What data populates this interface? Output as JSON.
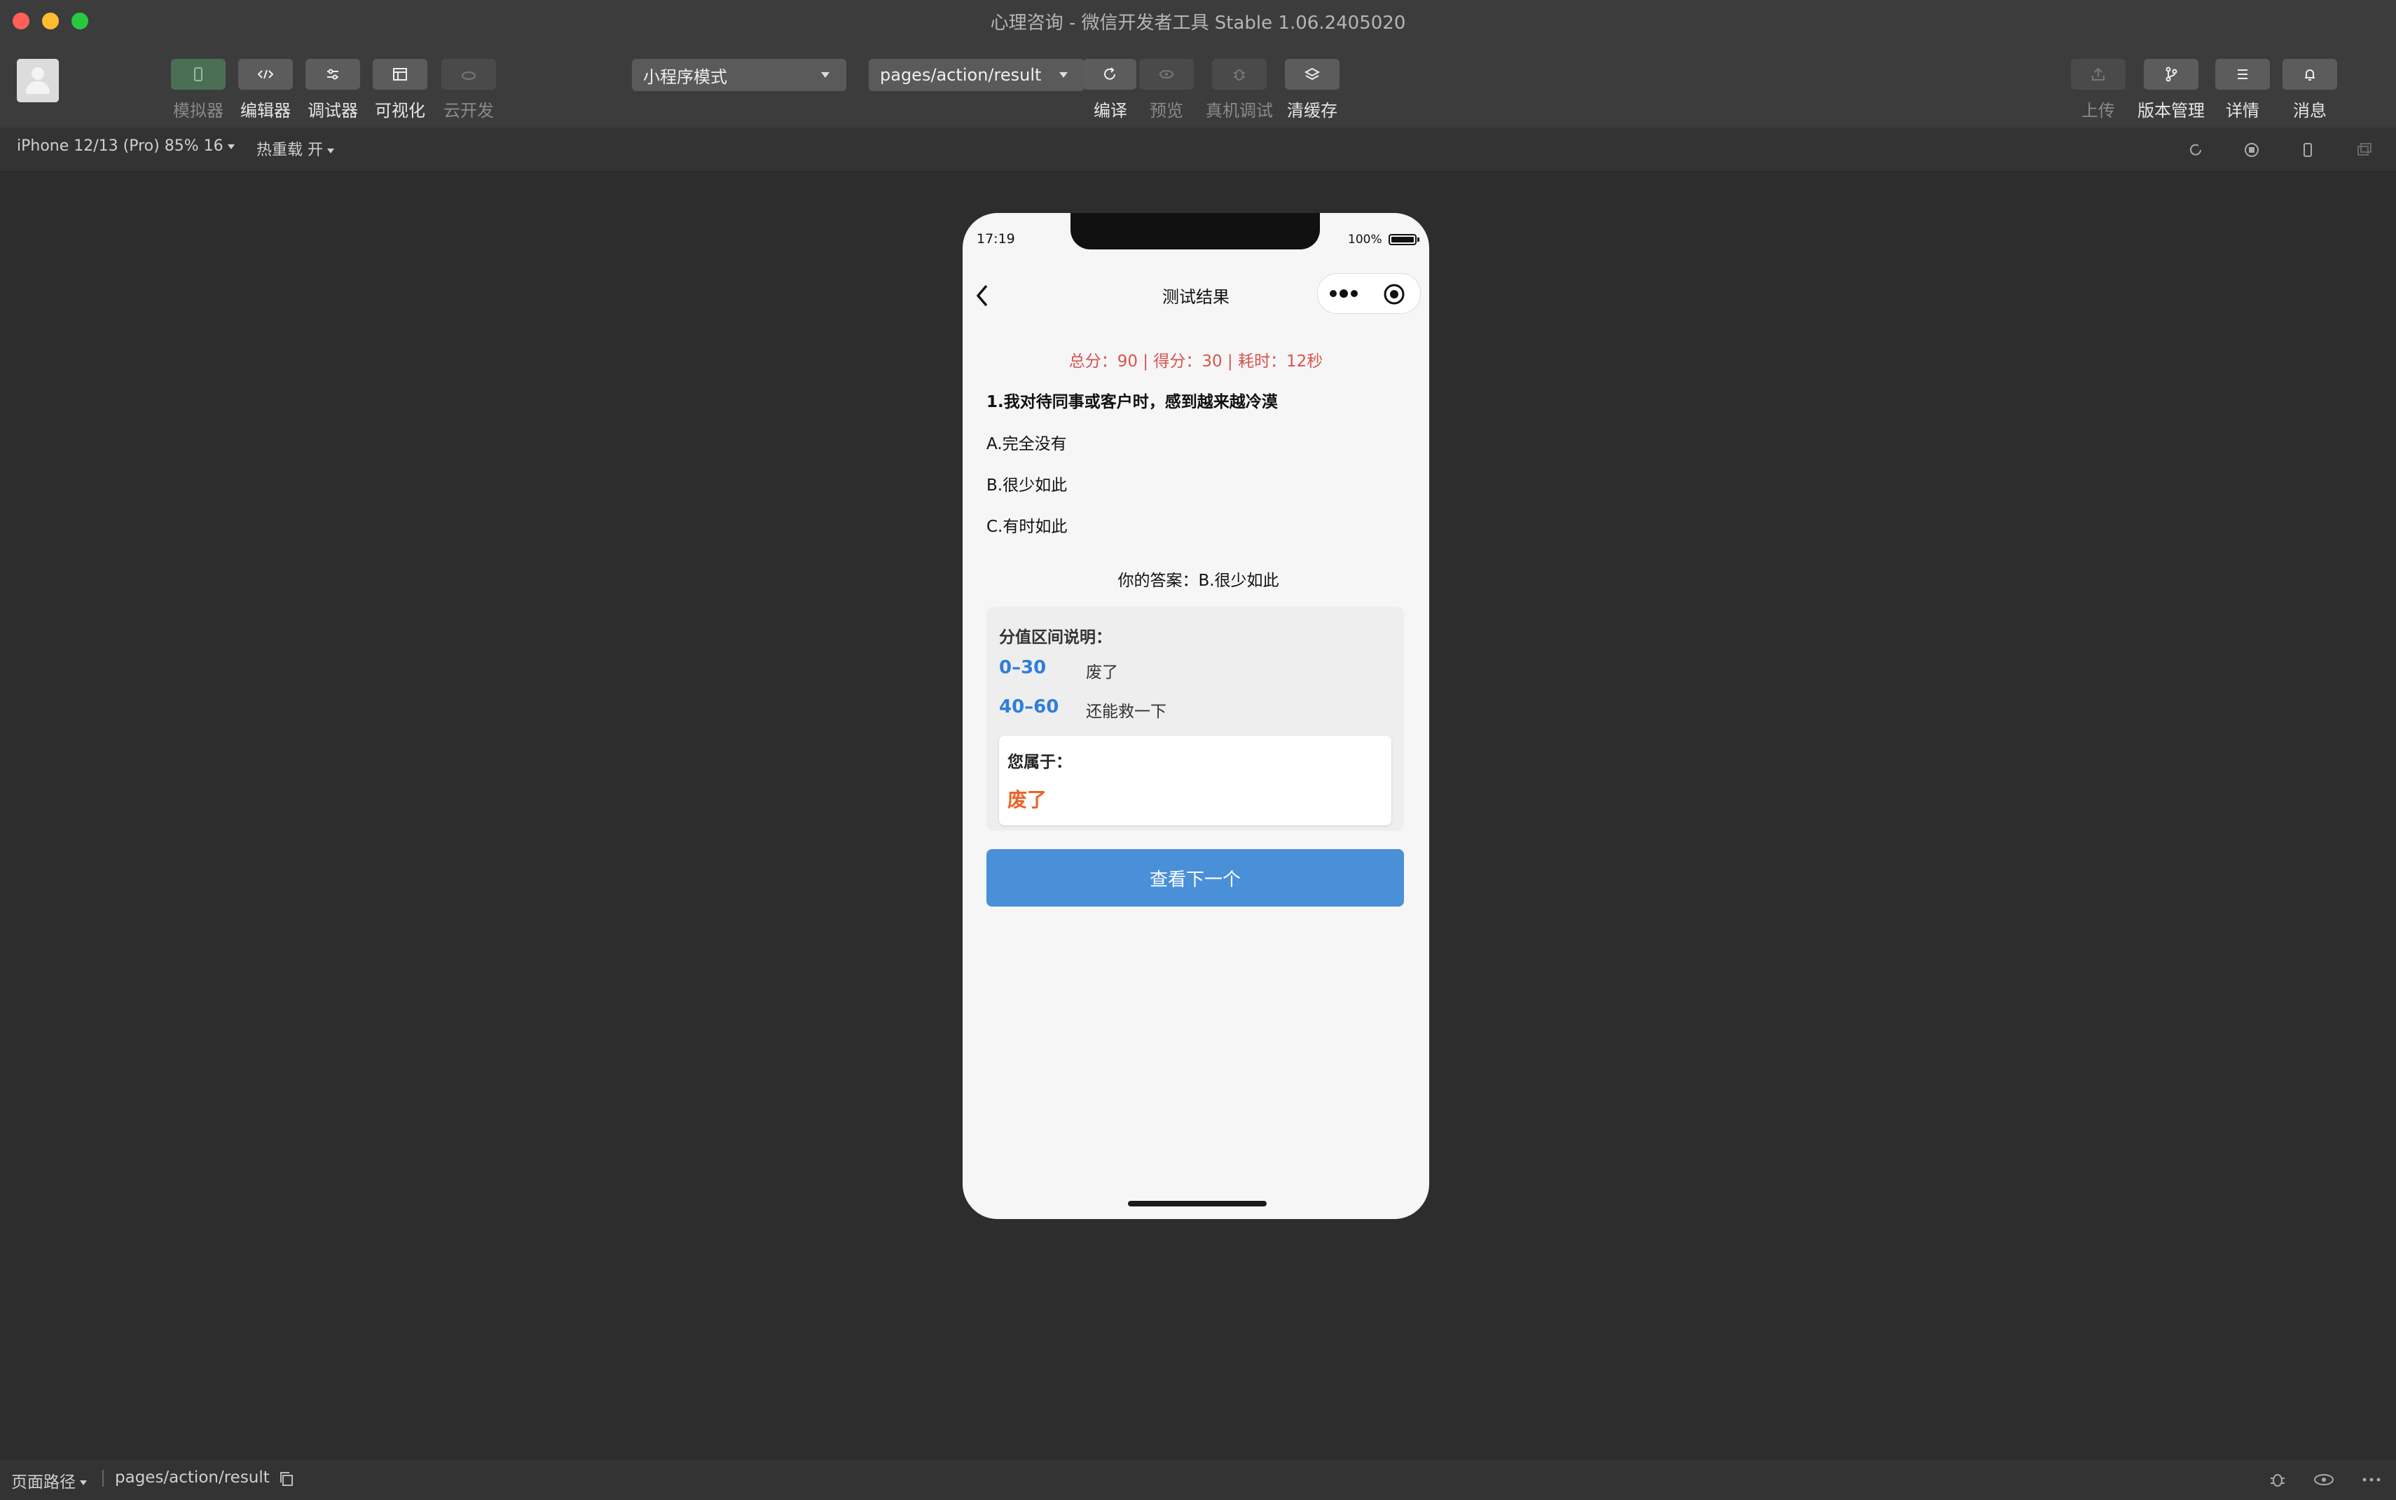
{
  "window": {
    "title": "心理咨询 - 微信开发者工具 Stable 1.06.2405020"
  },
  "toolbar": {
    "left": [
      {
        "label": "模拟器",
        "icon": "phone-icon"
      },
      {
        "label": "编辑器",
        "icon": "code-icon"
      },
      {
        "label": "调试器",
        "icon": "debug-icon"
      },
      {
        "label": "可视化",
        "icon": "layout-icon"
      },
      {
        "label": "云开发",
        "icon": "cloud-icon"
      }
    ],
    "mode_select": "小程序模式",
    "page_select": "pages/action/result",
    "center": [
      {
        "label": "编译",
        "icon": "refresh-icon"
      },
      {
        "label": "预览",
        "icon": "eye-icon"
      },
      {
        "label": "真机调试",
        "icon": "bug-icon"
      },
      {
        "label": "清缓存",
        "icon": "layers-icon"
      }
    ],
    "right": [
      {
        "label": "上传",
        "icon": "upload-icon"
      },
      {
        "label": "版本管理",
        "icon": "branch-icon"
      },
      {
        "label": "详情",
        "icon": "menu-icon"
      },
      {
        "label": "消息",
        "icon": "bell-icon"
      }
    ]
  },
  "subbar": {
    "device": "iPhone 12/13 (Pro) 85% 16",
    "hot_reload": "热重载 开"
  },
  "phone": {
    "status_time": "17:19",
    "battery": "100%",
    "nav_title": "测试结果",
    "summary": "总分：90 | 得分：30 | 耗时：12秒",
    "question": "1.我对待同事或客户时，感到越来越冷漠",
    "options": [
      "A.完全没有",
      "B.很少如此",
      "C.有时如此"
    ],
    "your_answer": "你的答案：B.很少如此",
    "score_title": "分值区间说明：",
    "ranges": [
      {
        "range": "0–30",
        "desc": "废了"
      },
      {
        "range": "40–60",
        "desc": "还能救一下"
      }
    ],
    "belong_label": "您属于：",
    "belong_value": "废了",
    "next_button": "查看下一个"
  },
  "statusbar": {
    "path_label": "页面路径",
    "path_value": "pages/action/result"
  },
  "colors": {
    "accent_blue": "#4a90d9",
    "summary_red": "#d9534f",
    "result_orange": "#e8652a",
    "range_blue": "#2f7ed8"
  }
}
